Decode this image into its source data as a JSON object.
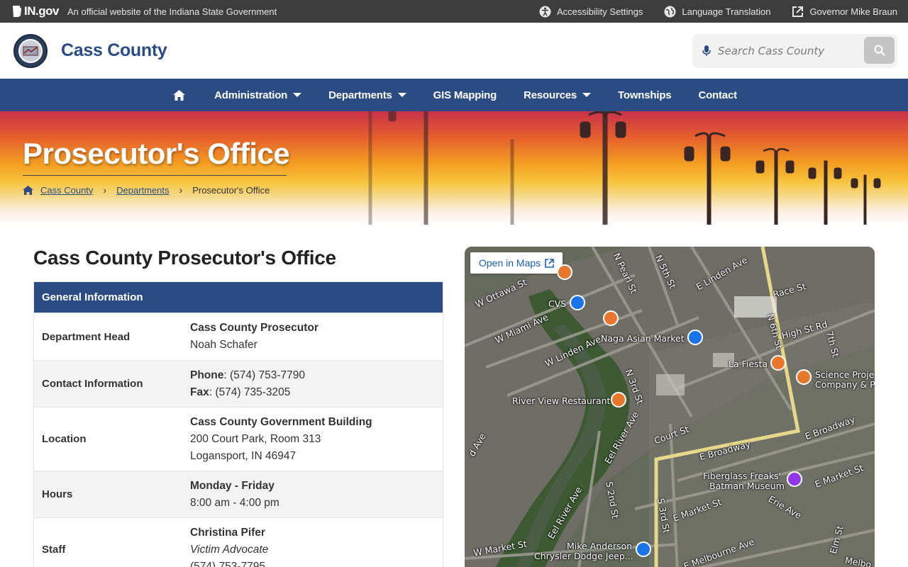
{
  "topbar": {
    "logo_text": "IN.gov",
    "official_text": "An official website of the Indiana State Government",
    "links": [
      {
        "label": "Accessibility Settings",
        "icon": "accessibility-icon"
      },
      {
        "label": "Language Translation",
        "icon": "globe-icon"
      },
      {
        "label": "Governor Mike Braun",
        "icon": "external-link-icon"
      }
    ]
  },
  "header": {
    "site_title": "Cass County",
    "search_placeholder": "Search Cass County"
  },
  "nav": {
    "items": [
      {
        "label": "Administration",
        "dropdown": true
      },
      {
        "label": "Departments",
        "dropdown": true
      },
      {
        "label": "GIS Mapping",
        "dropdown": false
      },
      {
        "label": "Resources",
        "dropdown": true
      },
      {
        "label": "Townships",
        "dropdown": false
      },
      {
        "label": "Contact",
        "dropdown": false
      }
    ]
  },
  "banner": {
    "title": "Prosecutor's Office",
    "breadcrumb": [
      "Cass County",
      "Departments",
      "Prosecutor's Office"
    ]
  },
  "main": {
    "heading": "Cass County Prosecutor's Office",
    "table_header": "General Information",
    "rows": [
      {
        "label": "Department Head",
        "lines": [
          "Cass County Prosecutor",
          "Noah Schafer"
        ]
      },
      {
        "label": "Contact Information",
        "phone_label": "Phone",
        "phone": ": (574) 753-7790",
        "fax_label": "Fax",
        "fax": ": (574) 735-3205"
      },
      {
        "label": "Location",
        "lines": [
          "Cass County Government Building",
          "200 Court Park, Room 313",
          "Logansport, IN 46947"
        ]
      },
      {
        "label": "Hours",
        "lines": [
          "Monday - Friday",
          "8:00 am - 4:00 pm"
        ]
      },
      {
        "label": "Staff",
        "lines": [
          "Christina Pifer",
          "Victim Advocate",
          "(574) 753-7795"
        ]
      }
    ]
  },
  "map": {
    "open_label": "Open in Maps",
    "labels": {
      "ottawa": "W Ottawa St",
      "cvs": "CVS",
      "miami": "W Miami Ave",
      "linden_w": "W Linden Ave",
      "naga": "Naga Asian Market",
      "pearl": "N Pearl St",
      "fifth": "N 5th St",
      "linden_e": "E Linden Ave",
      "race": "Race St",
      "sixteenth": "N 6th St",
      "highst": "High St Rd",
      "seventh": "7th St",
      "lafiesta": "La Fiesta",
      "science1": "Science Proje",
      "science2": "Company & P",
      "third": "N 3rd St",
      "riverview": "River View Restaurant",
      "eelriver": "Eel River Ave",
      "court": "Court St",
      "broadway_e": "E Broadway",
      "broadway_e2": "E Broadway",
      "fiber1": "Fiberglass Freaks'",
      "fiber2": "Batman Museum",
      "market_e": "E Market St",
      "market_e2": "E Market St",
      "erie": "Erie Ave",
      "s2nd": "S 2nd St",
      "s3rd": "S 3rd St",
      "eelriver2": "Eel River Ave",
      "ave_left": "d Ave",
      "market_w": "W Market St",
      "mike1": "Mike Anderson",
      "mike2": "Chrysler Dodge Jeep...",
      "melbourne": "E Melbourne Ave",
      "elm": "Elm St",
      "melbo": "Melbo"
    }
  }
}
